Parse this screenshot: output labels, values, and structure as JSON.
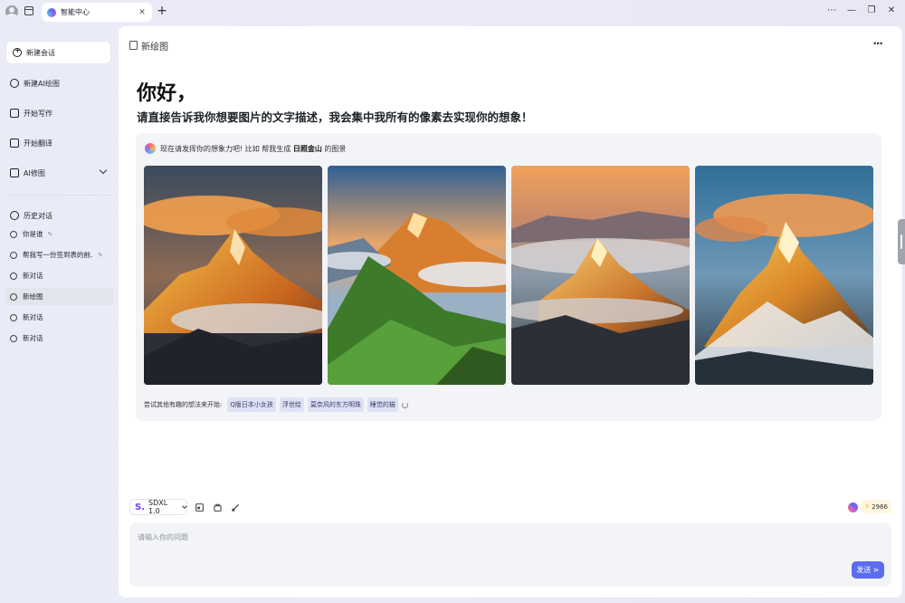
{
  "browser": {
    "tab_title": "智能中心",
    "tab_close": "✕",
    "new_tab": "+",
    "window_controls": [
      "⋯",
      "—",
      "❐",
      "✕"
    ]
  },
  "sidebar": {
    "new_chat": "新建会话",
    "items": [
      {
        "label": "新建AI绘图",
        "icon": "sparkle-icon"
      },
      {
        "label": "开始写作",
        "icon": "write-icon"
      },
      {
        "label": "开始翻译",
        "icon": "translate-icon"
      },
      {
        "label": "AI修图",
        "icon": "image-edit-icon"
      }
    ],
    "history_title": "历史对话",
    "history": [
      {
        "label": "你是谁",
        "pinned": true
      },
      {
        "label": "帮我写一份签到表的前...",
        "pinned": true
      },
      {
        "label": "新对话",
        "pinned": false
      },
      {
        "label": "新绘图",
        "pinned": false,
        "active": true
      },
      {
        "label": "新对话",
        "pinned": false
      },
      {
        "label": "新对话",
        "pinned": false
      }
    ]
  },
  "main": {
    "page_title": "新绘图",
    "greeting": "你好，",
    "subtitle": "请直接告诉我你想要图片的文字描述，我会集中我所有的像素去实现你的想象！",
    "prompt": {
      "prefix": "现在请发挥你的想象力吧! 比如 帮我生成",
      "highlight": "日照金山",
      "suffix": "的图景"
    },
    "images": [
      "golden-mountain-image-1",
      "golden-mountain-image-2",
      "golden-mountain-image-3",
      "golden-mountain-image-4"
    ],
    "try_label": "尝试其他有趣的想法来开始:",
    "suggestions": [
      "Q版日本小女孩",
      "浮世绘",
      "莫奈风的东方明珠",
      "睡觉的猫"
    ]
  },
  "composer": {
    "model_logo": "S.",
    "model": "SDXL 1.0",
    "credits": "2966",
    "placeholder": "请输入你的问题",
    "send": "发送 ⋗"
  },
  "colors": {
    "accent": "#5b6cf0",
    "chip_bg": "#dfe1f5",
    "card_bg": "#f3f4f7"
  }
}
